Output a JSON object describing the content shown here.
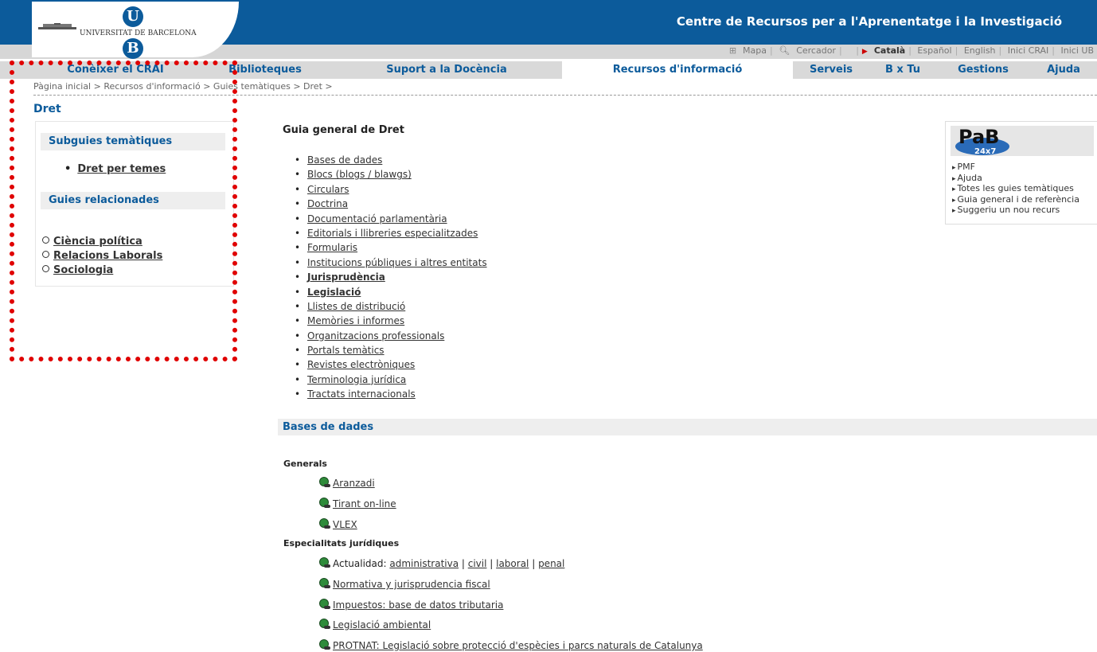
{
  "header": {
    "university": "UNIVERSITAT DE BARCELONA",
    "logo_letters": [
      "U",
      "B"
    ],
    "site_title": "Centre de Recursos per a l'Aprenentatge i la Investigació",
    "brand_color": "#0c5b9b"
  },
  "toplinks": {
    "mapa": "Mapa",
    "cercador": "Cercador",
    "lang_current": "Català",
    "lang_es": "Español",
    "lang_en": "English",
    "inici_crai": "Inici CRAI",
    "inici_ub": "Inici UB"
  },
  "nav": [
    "Conèixer el CRAI",
    "Biblioteques",
    "Suport a la Docència",
    "Recursos d'informació",
    "Serveis",
    "B x Tu",
    "Gestions",
    "Ajuda"
  ],
  "nav_active": "Recursos d'informació",
  "breadcrumb": "Pàgina inicial > Recursos d'informació > Guies temàtiques > Dret >",
  "page_title": "Dret",
  "left": {
    "subguies_title": "Subguies temàtiques",
    "subguies": [
      "Dret per temes"
    ],
    "related_title": "Guies relacionades",
    "related": [
      "Ciència política",
      "Relacions Laborals",
      "Sociologia"
    ]
  },
  "main": {
    "title": "Guia general de Dret",
    "toc": [
      {
        "label": "Bases de dades",
        "bold": false
      },
      {
        "label": "Blocs (blogs / blawgs)",
        "bold": false
      },
      {
        "label": "Circulars",
        "bold": false
      },
      {
        "label": "Doctrina",
        "bold": false
      },
      {
        "label": "Documentació parlamentària",
        "bold": false
      },
      {
        "label": "Editorials i llibreries especialitzades",
        "bold": false
      },
      {
        "label": "Formularis",
        "bold": false
      },
      {
        "label": "Institucions públiques i altres entitats",
        "bold": false
      },
      {
        "label": "Jurisprudència",
        "bold": true
      },
      {
        "label": "Legislació",
        "bold": true
      },
      {
        "label": "Llistes de distribució",
        "bold": false
      },
      {
        "label": "Memòries i informes",
        "bold": false
      },
      {
        "label": "Organitzacions professionals",
        "bold": false
      },
      {
        "label": "Portals temàtics",
        "bold": false
      },
      {
        "label": "Revistes electròniques",
        "bold": false
      },
      {
        "label": "Terminologia jurídica",
        "bold": false
      },
      {
        "label": "Tractats internacionals",
        "bold": false
      }
    ],
    "section_title": "Bases de dades",
    "cat_generals": "Generals",
    "generals": [
      "Aranzadi",
      "Tirant on-line",
      "VLEX"
    ],
    "cat_especialitats": "Especialitats jurídiques",
    "actualidad_prefix": "Actualidad:",
    "actualidad_links": [
      "administrativa",
      "civil",
      "laboral",
      "penal"
    ],
    "especialitats": [
      "Normativa y jurisprudencia fiscal",
      "Impuestos: base de datos tributaria",
      "Legislació ambiental",
      "PROTNAT: Legislació sobre protecció d'espècies i parcs naturals de Catalunya"
    ]
  },
  "rightbox": {
    "logo_text": "PaB",
    "logo_sub": "24x7",
    "links": [
      "PMF",
      "Ajuda",
      "Totes les guies temàtiques",
      "Guia general i de referència",
      "Suggeriu un nou recurs"
    ]
  },
  "annotation_color": "#e00000"
}
